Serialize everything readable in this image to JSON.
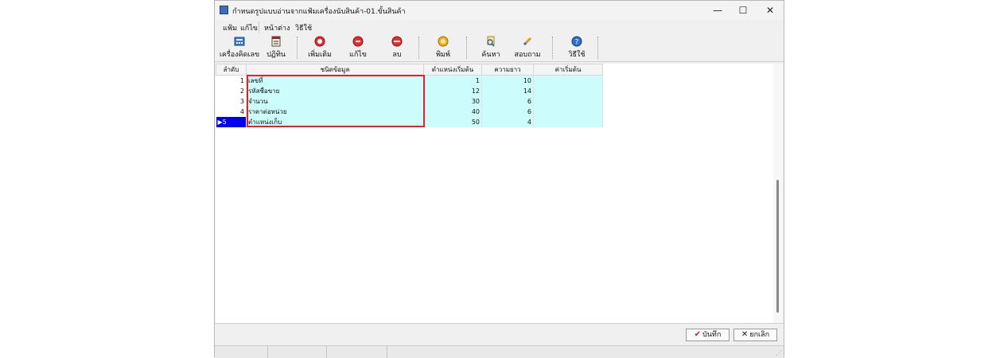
{
  "window": {
    "title": "กำหนดรูปแบบอ่านจากแฟ้มเครื่องนับสินค้า-01.ขั้นสินค้า",
    "minimize_glyph": "—",
    "maximize_glyph": "☐",
    "close_glyph": "✕"
  },
  "menu": {
    "items": [
      "แฟ้ม",
      "แก้ไข",
      "หน้าต่าง",
      "วิธีใช้"
    ]
  },
  "toolbar": {
    "calculator": "เครื่องคิดเลข",
    "calendar": "ปฏิทิน",
    "add": "เพิ่มเติม",
    "edit": "แก้ไข",
    "delete": "ลบ",
    "print": "พิมพ์",
    "search": "ค้นหา",
    "inquiry": "สอบถาม",
    "help": "วิธีใช้"
  },
  "grid": {
    "headers": [
      "ลำดับ",
      "ชนิดข้อมูล",
      "ตำแหน่งเริ่มต้น",
      "ความยาว",
      "ค่าเริ่มต้น"
    ],
    "rows": [
      {
        "seq": "1",
        "type": "เลขที่",
        "start": "1",
        "length": "10",
        "default": ""
      },
      {
        "seq": "2",
        "type": "รหัสชื่อขาย",
        "start": "12",
        "length": "14",
        "default": ""
      },
      {
        "seq": "3",
        "type": "จำนวน",
        "start": "30",
        "length": "6",
        "default": ""
      },
      {
        "seq": "4",
        "type": "ราคาต่อหน่วย",
        "start": "40",
        "length": "6",
        "default": ""
      },
      {
        "seq": "5",
        "type": "ตำแหน่งเก็บ",
        "start": "50",
        "length": "4",
        "default": ""
      }
    ]
  },
  "buttons": {
    "save": "บันทึก",
    "cancel": "ยกเลิก"
  },
  "colors": {
    "row_fill": "#ccfcfc",
    "selected_row_header": "#0000ee",
    "highlight_box": "#e0202a"
  }
}
